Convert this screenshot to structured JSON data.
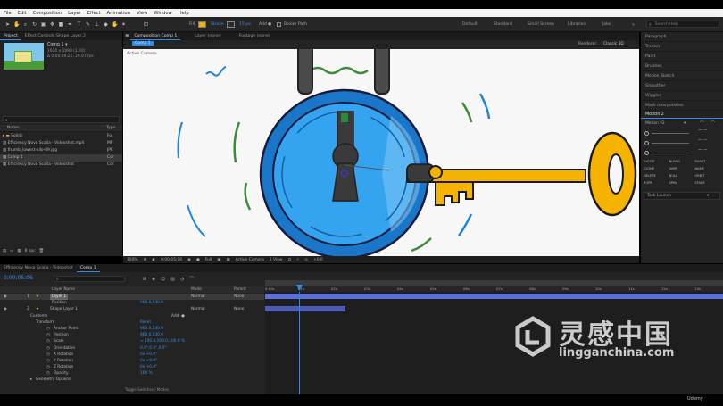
{
  "menu": [
    "File",
    "Edit",
    "Composition",
    "Layer",
    "Effect",
    "Animation",
    "View",
    "Window",
    "Help"
  ],
  "toolbar": {
    "fill_label": "Fill",
    "stroke_label": "Stroke",
    "stroke_width": "15 px",
    "add_label": "Add",
    "bezier_label": "Bezier Path",
    "workspaces": [
      "Default",
      "Standard",
      "Small Screen",
      "Libraries",
      "Jake"
    ],
    "search_placeholder": "Search Help"
  },
  "project_panel": {
    "tabs": [
      "Project",
      "Effect Controls Shape Layer 2"
    ],
    "comp_name": "Comp 1 ▾",
    "comp_info": [
      "1920 x 1080 (1.00)",
      "Δ 0;00;09;26, 29.97 fps"
    ],
    "col_name": "Name",
    "col_type": "Type",
    "items": [
      {
        "name": "Solids",
        "type": "Fol"
      },
      {
        "name": "Efficiency Nova Scalia - Videoshot.mp4",
        "type": "MP"
      },
      {
        "name": "thumb_lowest-kilo-69.jpg",
        "type": "JPE"
      },
      {
        "name": "Comp 1",
        "type": "Cor"
      },
      {
        "name": "Efficiency Nova Scalia - Videoshot",
        "type": "Cor"
      }
    ],
    "footer_bpc": "8 bpc"
  },
  "composition_panel": {
    "tabs": [
      "Composition Comp 1",
      "Layer (none)",
      "Footage (none)"
    ],
    "subtab": "Comp 1",
    "renderer": "Renderer:",
    "renderer_value": "Classic 3D",
    "active_camera": "Active Camera",
    "footer": {
      "zoom": "100%",
      "timecode": "0;00;05;06",
      "resolution": "Full",
      "camera": "Active Camera",
      "views": "1 View",
      "offset": "+0.0"
    }
  },
  "right_panel": {
    "items": [
      "Paragraph",
      "Tracker",
      "Paint",
      "Brushes",
      "Motion Sketch",
      "Smoother",
      "Wiggler",
      "Mask Interpolation"
    ],
    "motion_title": "Motion 2",
    "motion_version": "Motion v2",
    "buttons": [
      "EXCITE",
      "BLEND",
      "BURST",
      "CLONE",
      "JUMP",
      "NAME",
      "DELETE",
      "NULL",
      "ORBIT",
      "ROPE",
      "SPIN",
      "STARE"
    ],
    "dropdown": "Task Launch"
  },
  "timeline": {
    "tabs": [
      "Efficiency Nova Scalia - Videoshot",
      "Comp 1"
    ],
    "current_time": "0;00;05;06",
    "search_placeholder": "",
    "col_layer": "Layer Name",
    "col_mode": "Mode",
    "col_parent": "Parent",
    "layers": [
      {
        "num": "1",
        "name": "Layer 1",
        "mode": "Normal",
        "parent": "None"
      },
      {
        "num": "2",
        "name": "Shape Layer 1",
        "mode": "Normal",
        "parent": "None"
      }
    ],
    "props": [
      {
        "name": "Position",
        "value": "960.0,540.0"
      },
      {
        "name": "Contents",
        "value": "Add: ●"
      },
      {
        "name": "Transform",
        "value": "Reset"
      },
      {
        "name": "Anchor Point",
        "value": "960.0,540.0"
      },
      {
        "name": "Position",
        "value": "960.0,540.0"
      },
      {
        "name": "Scale",
        "value": "∞ 100.0,100.0,100.0 %"
      },
      {
        "name": "Orientation",
        "value": "0.0°,0.0°,0.0°"
      },
      {
        "name": "X Rotation",
        "value": "0x +0.0°"
      },
      {
        "name": "Y Rotation",
        "value": "0x +0.0°"
      },
      {
        "name": "Z Rotation",
        "value": "0x +0.0°"
      },
      {
        "name": "Opacity",
        "value": "100 %"
      },
      {
        "name": "Geometry Options",
        "value": ""
      }
    ],
    "ruler": [
      "0:00s",
      "01s",
      "02s",
      "03s",
      "04s",
      "05s",
      "06s",
      "07s",
      "08s",
      "09s",
      "10s",
      "11s",
      "12s",
      "13s"
    ],
    "footer": "Toggle Switches / Modes"
  },
  "watermark": {
    "cn": "灵感中国",
    "url": "lingganchina.com",
    "udemy": "Udemy"
  },
  "colors": {
    "accent": "#2d8ceb",
    "lock_blue": "#1f84d9",
    "key_yellow": "#f5b300",
    "canvas_bg": "#f7f7f7"
  }
}
